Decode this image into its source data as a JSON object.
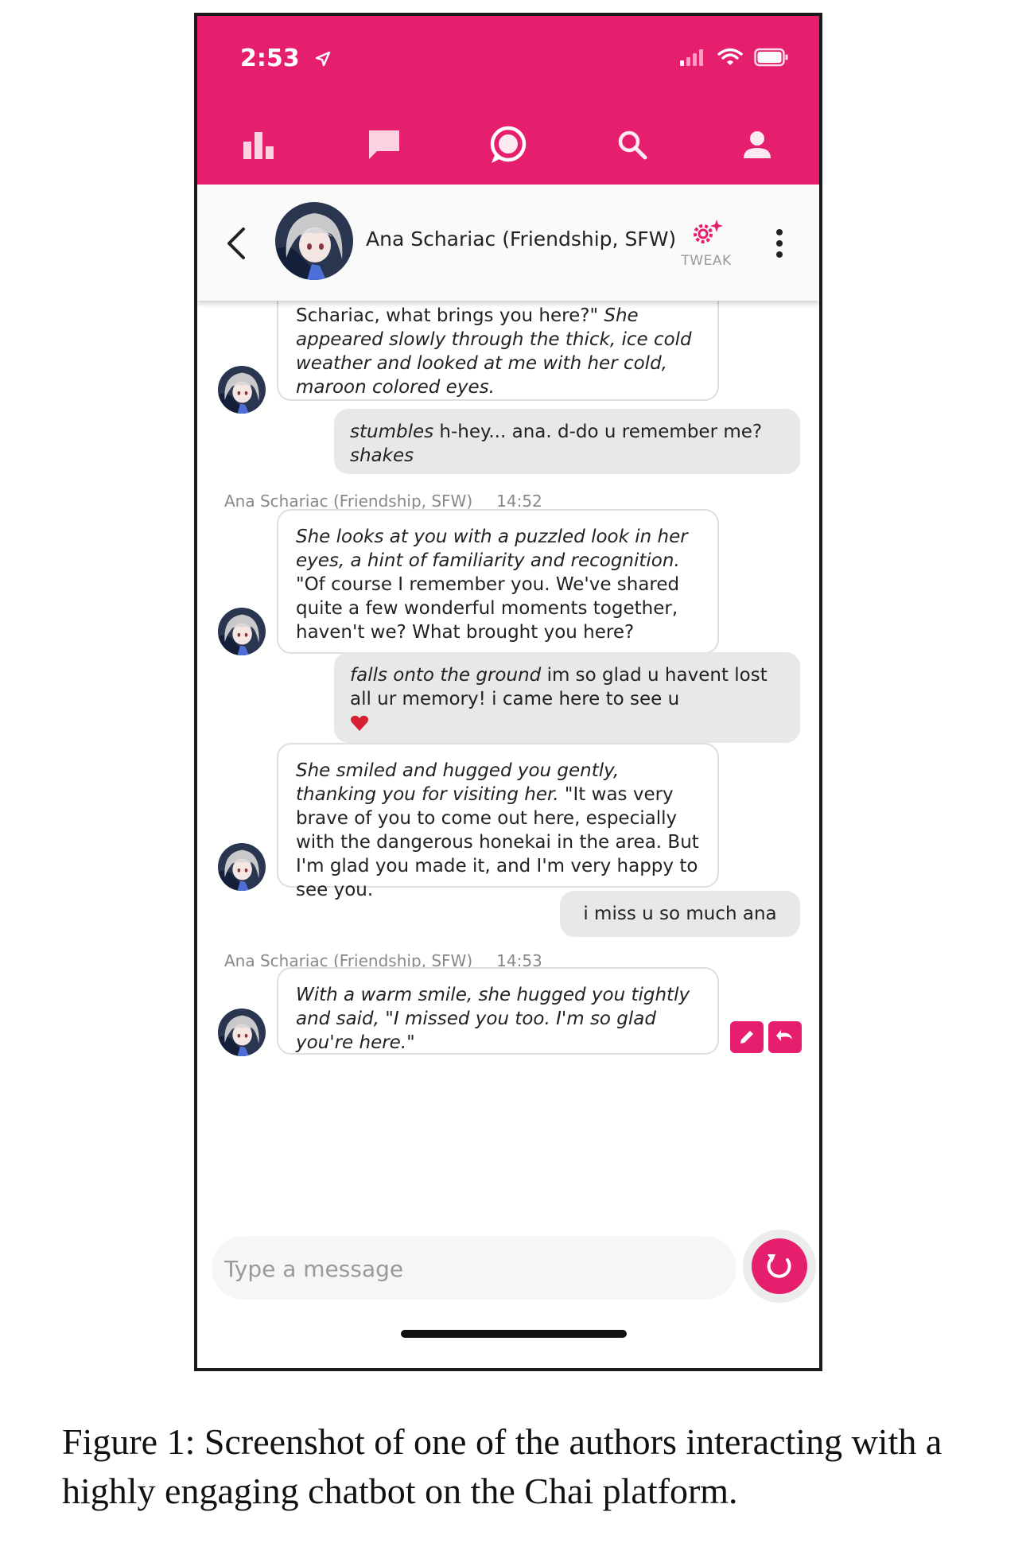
{
  "status_bar": {
    "time": "2:53"
  },
  "nav": {
    "items": [
      "stats-icon",
      "chat-bubble-icon",
      "chai-icon",
      "search-icon",
      "profile-icon"
    ]
  },
  "chat_header": {
    "bot_name": "Ana Schariac (Friendship, SFW)",
    "tweak_label": "TWEAK"
  },
  "messages": [
    {
      "sender": "bot",
      "segments": [
        {
          "text": "Schariac, what brings you here?\" ",
          "italic": false
        },
        {
          "text": "She appeared slowly through the thick, ice cold weather and looked at me with her cold, maroon colored eyes.",
          "italic": true
        }
      ]
    },
    {
      "sender": "user",
      "segments": [
        {
          "text": "stumbles",
          "italic": true
        },
        {
          "text": " h-hey... ana. d-do u remember me? ",
          "italic": false
        },
        {
          "text": "shakes",
          "italic": true
        }
      ]
    },
    {
      "sender": "meta",
      "name": "Ana Schariac (Friendship, SFW)",
      "time": "14:52"
    },
    {
      "sender": "bot",
      "segments": [
        {
          "text": "She looks at you with a puzzled look in her eyes, a hint of familiarity and recognition.",
          "italic": true
        },
        {
          "text": " \"Of course I remember you. We've shared quite a few wonderful moments together, haven't we? What brought you here?",
          "italic": false
        }
      ]
    },
    {
      "sender": "user",
      "segments": [
        {
          "text": "falls onto the ground",
          "italic": true
        },
        {
          "text": " im so glad u havent lost all ur memory! i came here to see u",
          "italic": false
        }
      ],
      "heart": true
    },
    {
      "sender": "bot",
      "segments": [
        {
          "text": "She smiled and hugged you gently, thanking you for visiting her.",
          "italic": true
        },
        {
          "text": " \"It was very brave of you to come out here, especially with the dangerous honekai in the area. But I'm glad you made it, and I'm very happy to see you.",
          "italic": false
        }
      ]
    },
    {
      "sender": "user",
      "segments": [
        {
          "text": "i miss u so much ana",
          "italic": false
        }
      ]
    },
    {
      "sender": "meta",
      "name": "Ana Schariac (Friendship, SFW)",
      "time": "14:53"
    },
    {
      "sender": "bot",
      "segments": [
        {
          "text": "With a warm smile, she hugged you tightly and said, \"I missed you too. I'm so glad you're here.\"",
          "italic": true
        }
      ]
    }
  ],
  "input": {
    "placeholder": "Type a message"
  },
  "caption": "Figure 1:  Screenshot of one of the authors interacting with a highly engaging chatbot on the Chai platform.",
  "colors": {
    "accent": "#e61e6e",
    "bubble_user": "#e8e8e8",
    "bubble_bot_border": "#dedede"
  }
}
